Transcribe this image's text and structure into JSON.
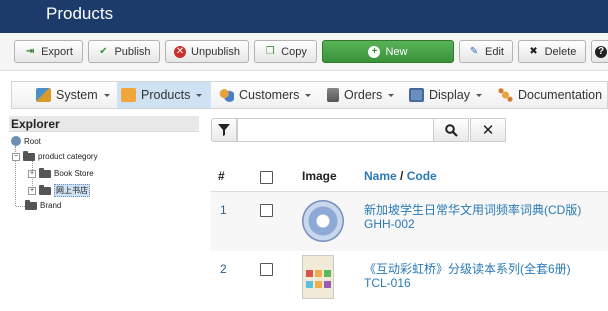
{
  "header": {
    "title": "Products"
  },
  "toolbar": {
    "export": "Export",
    "publish": "Publish",
    "unpublish": "Unpublish",
    "copy": "Copy",
    "new": "New",
    "edit": "Edit",
    "delete": "Delete"
  },
  "menu": {
    "system": "System",
    "products": "Products",
    "customers": "Customers",
    "orders": "Orders",
    "display": "Display",
    "documentation": "Documentation"
  },
  "explorer": {
    "title": "Explorer",
    "root": "Root",
    "category": "product category",
    "book_store": "Book Store",
    "online_store": "网上书店",
    "brand": "Brand"
  },
  "search": {
    "value": ""
  },
  "table": {
    "headers": {
      "num": "#",
      "image": "Image",
      "name": "Name",
      "sep": "/",
      "code": "Code"
    },
    "rows": [
      {
        "num": "1",
        "name": "新加坡学生日常华文用词频率词典(CD版)",
        "code": "GHH-002"
      },
      {
        "num": "2",
        "name": "《互动彩虹桥》分级读本系列(全套6册)",
        "code": "TCL-016"
      }
    ]
  },
  "colors": {
    "header_bg": "#1c3b6a",
    "new_button": "#46a546",
    "link": "#2a7ab5",
    "active_menu": "#cfe2f3"
  }
}
